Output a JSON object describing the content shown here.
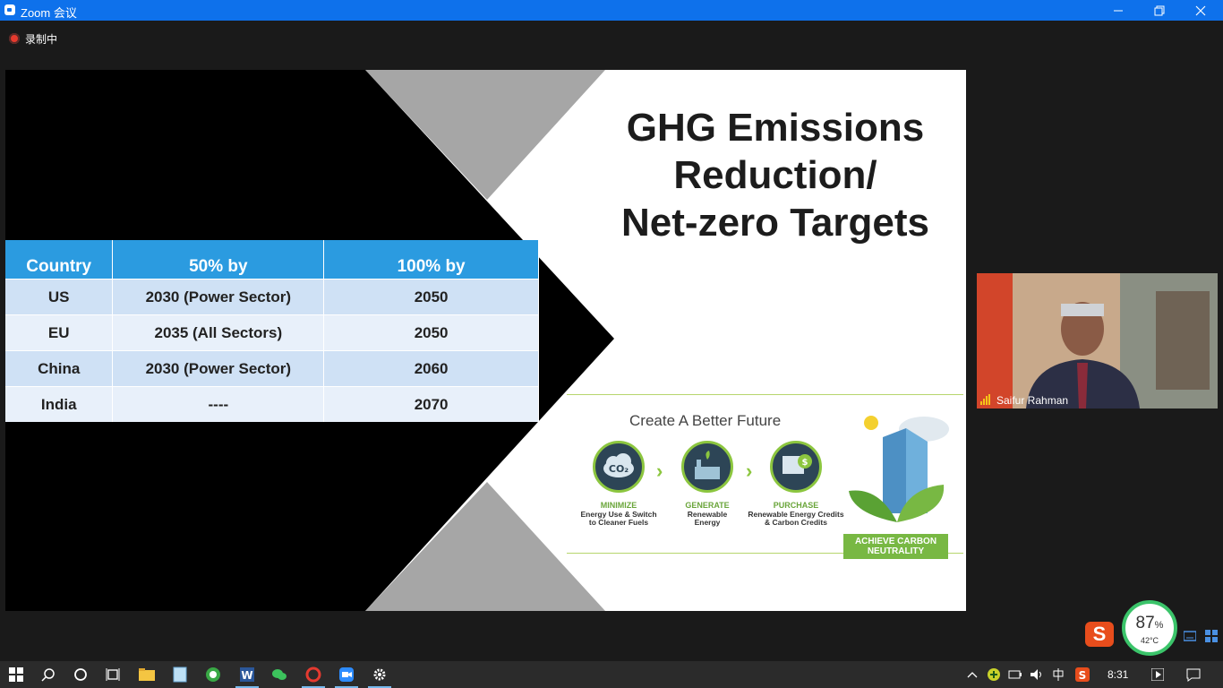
{
  "window": {
    "title": "Zoom 会议"
  },
  "recording": {
    "label": "录制中"
  },
  "slide": {
    "title_lines": [
      "GHG Emissions",
      "Reduction/",
      "Net-zero Targets"
    ],
    "table": {
      "headers": [
        "Country",
        "50% by",
        "100% by"
      ],
      "rows": [
        [
          "US",
          "2030 (Power Sector)",
          "2050"
        ],
        [
          "EU",
          "2035 (All Sectors)",
          "2050"
        ],
        [
          "China",
          "2030 (Power Sector)",
          "2060"
        ],
        [
          "India",
          "----",
          "2070"
        ]
      ]
    },
    "graphic": {
      "heading": "Create A Better Future",
      "co2_label": "CO₂",
      "steps": [
        {
          "title": "MINIMIZE",
          "desc_1": "Energy Use & Switch",
          "desc_2": "to Cleaner Fuels"
        },
        {
          "title": "GENERATE",
          "desc_1": "Renewable",
          "desc_2": "Energy"
        },
        {
          "title": "PURCHASE",
          "desc_1": "Renewable Energy Credits",
          "desc_2": "& Carbon Credits"
        }
      ],
      "achieve_1": "ACHIEVE CARBON",
      "achieve_2": "NEUTRALITY"
    }
  },
  "participant": {
    "name": "Saifur Rahman"
  },
  "taskbar": {
    "time": "8:31"
  },
  "perf_widget": {
    "percent": "87",
    "percent_sign": "%",
    "temperature": "42°C"
  },
  "colors": {
    "titlebar": "#0e71eb",
    "table_header": "#2b9be0",
    "accent_green": "#8cc63f"
  }
}
